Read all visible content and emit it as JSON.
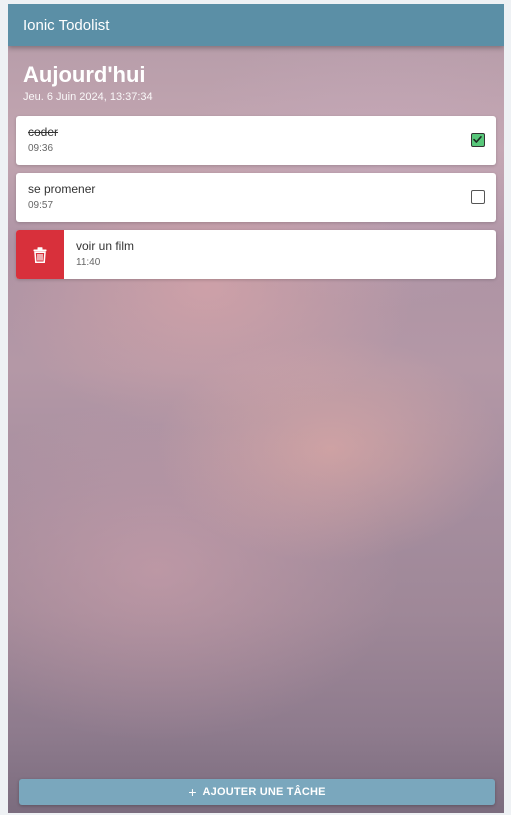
{
  "header": {
    "title": "Ionic Todolist"
  },
  "day": {
    "title": "Aujourd'hui",
    "date": "Jeu. 6 Juin 2024, 13:37:34"
  },
  "tasks": [
    {
      "title": "coder",
      "time": "09:36",
      "done": true
    },
    {
      "title": "se promener",
      "time": "09:57",
      "done": false
    },
    {
      "title": "voir un film",
      "time": "11:40",
      "swiped": true
    }
  ],
  "add_button": {
    "icon": "plus-icon",
    "label": "AJOUTER UNE TÂCHE"
  },
  "colors": {
    "header": "#5b8fa6",
    "add_button": "#7aa7bd",
    "delete": "#d8303b",
    "checked": "#58c77a"
  }
}
